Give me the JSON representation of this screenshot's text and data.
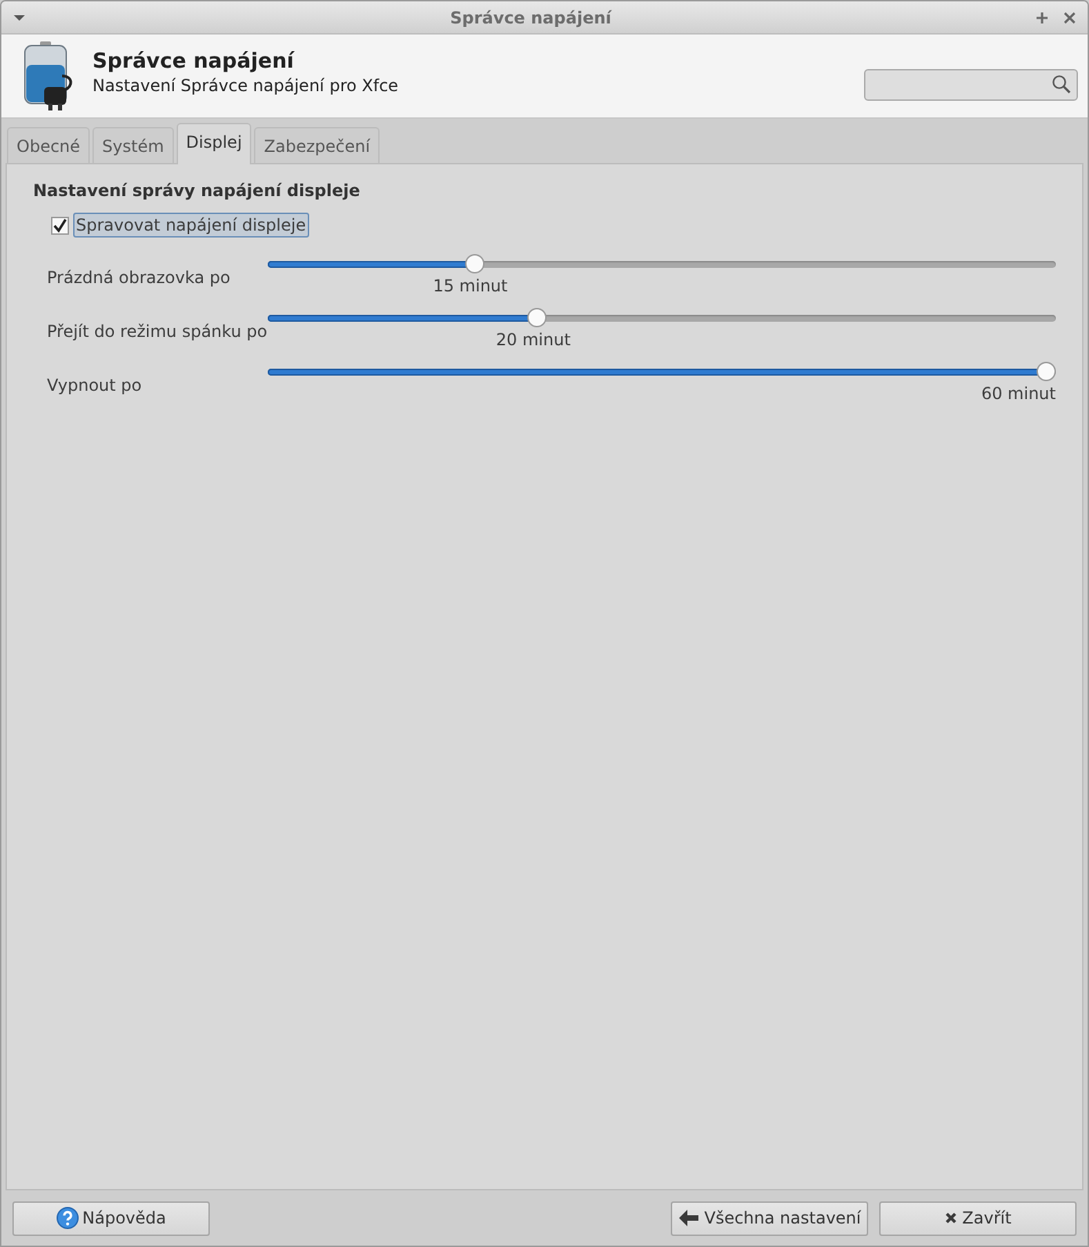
{
  "window": {
    "title": "Správce napájení"
  },
  "header": {
    "title": "Správce napájení",
    "subtitle": "Nastavení Správce napájení pro Xfce"
  },
  "tabs": [
    {
      "label": "Obecné",
      "selected": false
    },
    {
      "label": "Systém",
      "selected": false
    },
    {
      "label": "Displej",
      "selected": true
    },
    {
      "label": "Zabezpečení",
      "selected": false
    }
  ],
  "section": {
    "title": "Nastavení správy napájení displeje",
    "checkbox": {
      "label": "Spravovat napájení displeje",
      "checked": true
    }
  },
  "sliders": [
    {
      "name": "Prázdná obrazovka po",
      "level": 0.257,
      "reading": "15 minut"
    },
    {
      "name": "Přejít do režimu spánku po",
      "level": 0.337,
      "reading": "20 minut"
    },
    {
      "name": "Vypnout po",
      "level": 1,
      "reading": "60 minut"
    }
  ],
  "buttons": [
    {
      "kind": "help",
      "label": "Nápověda"
    },
    {
      "kind": "back",
      "label": "Všechna nastavení"
    },
    {
      "kind": "close",
      "label": "Zavřít"
    }
  ]
}
